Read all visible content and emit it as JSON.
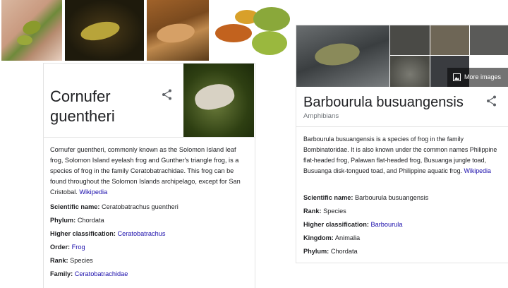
{
  "left_card": {
    "title_line1": "Cornufer",
    "title_line2": "guentheri",
    "description": "Cornufer guentheri, commonly known as the Solomon Island leaf frog, Solomon Island eyelash frog and Gunther's triangle frog, is a species of frog in the family Ceratobatrachidae. This frog can be found throughout the Solomon Islands archipelago, except for San Cristobal.",
    "wiki_link": "Wikipedia",
    "facts": [
      {
        "label": "Scientific name:",
        "value": "Ceratobatrachus guentheri",
        "is_link": false
      },
      {
        "label": "Phylum:",
        "value": "Chordata",
        "is_link": false
      },
      {
        "label": "Higher classification:",
        "value": "Ceratobatrachus",
        "is_link": true
      },
      {
        "label": "Order:",
        "value": "Frog",
        "is_link": true
      },
      {
        "label": "Rank:",
        "value": "Species",
        "is_link": false
      },
      {
        "label": "Family:",
        "value": "Ceratobatrachidae",
        "is_link": true
      }
    ]
  },
  "right_card": {
    "title": "Barbourula busuangensis",
    "subtitle": "Amphibians",
    "more_images": "More images",
    "description": "Barbourula busuangensis is a species of frog in the family Bombinatoridae. It is also known under the common names Philippine flat-headed frog, Palawan flat-headed frog, Busuanga jungle toad, Busuanga disk-tongued toad, and Philippine aquatic frog.",
    "wiki_link": "Wikipedia",
    "facts": [
      {
        "label": "Scientific name:",
        "value": "Barbourula busuangensis",
        "is_link": false
      },
      {
        "label": "Rank:",
        "value": "Species",
        "is_link": false
      },
      {
        "label": "Higher classification:",
        "value": "Barbourula",
        "is_link": true
      },
      {
        "label": "Kingdom:",
        "value": "Animalia",
        "is_link": false
      },
      {
        "label": "Phylum:",
        "value": "Chordata",
        "is_link": false
      }
    ]
  },
  "colors": {
    "link": "#1a0dab",
    "text": "#202124",
    "subtle": "#70757a"
  }
}
